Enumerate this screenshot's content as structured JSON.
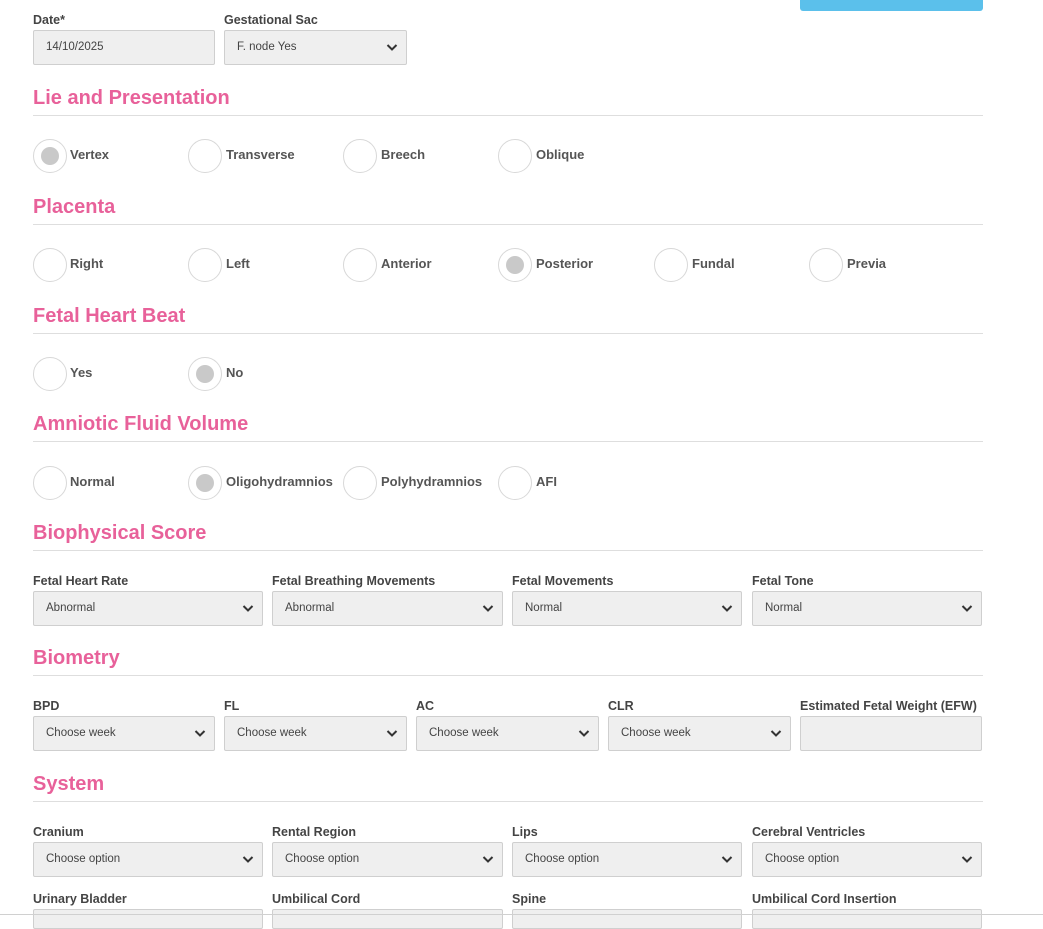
{
  "header": {
    "date_label": "Date*",
    "date_value": "14/10/2025",
    "sac_label": "Gestational Sac",
    "sac_value": "F. node Yes"
  },
  "lie": {
    "title": "Lie and Presentation",
    "options": [
      "Vertex",
      "Transverse",
      "Breech",
      "Oblique"
    ],
    "selected": "Vertex"
  },
  "placenta": {
    "title": "Placenta",
    "options": [
      "Right",
      "Left",
      "Anterior",
      "Posterior",
      "Fundal",
      "Previa"
    ],
    "selected": "Posterior"
  },
  "heartbeat": {
    "title": "Fetal Heart Beat",
    "options": [
      "Yes",
      "No"
    ],
    "selected": "No"
  },
  "fluid": {
    "title": "Amniotic Fluid Volume",
    "options": [
      "Normal",
      "Oligohydramnios",
      "Polyhydramnios",
      "AFI"
    ],
    "selected": "Oligohydramnios"
  },
  "biophysical": {
    "title": "Biophysical Score",
    "fields": [
      {
        "label": "Fetal Heart Rate",
        "value": "Abnormal"
      },
      {
        "label": "Fetal Breathing Movements",
        "value": "Abnormal"
      },
      {
        "label": "Fetal Movements",
        "value": "Normal"
      },
      {
        "label": "Fetal Tone",
        "value": "Normal"
      }
    ]
  },
  "biometry": {
    "title": "Biometry",
    "fields": [
      {
        "label": "BPD",
        "value": "Choose week"
      },
      {
        "label": "FL",
        "value": "Choose week"
      },
      {
        "label": "AC",
        "value": "Choose week"
      },
      {
        "label": "CLR",
        "value": "Choose week"
      }
    ],
    "efw_label": "Estimated Fetal Weight (EFW)",
    "efw_value": ""
  },
  "system": {
    "title": "System",
    "fields": [
      {
        "label": "Cranium",
        "value": "Choose option"
      },
      {
        "label": "Rental Region",
        "value": "Choose option"
      },
      {
        "label": "Lips",
        "value": "Choose option"
      },
      {
        "label": "Cerebral Ventricles",
        "value": "Choose option"
      }
    ],
    "row2_labels": [
      "Urinary Bladder",
      "Umbilical Cord",
      "Spine",
      "Umbilical Cord Insertion"
    ]
  },
  "colors": {
    "accent_pink": "#e8619a",
    "button_blue": "#5bc0eb"
  }
}
